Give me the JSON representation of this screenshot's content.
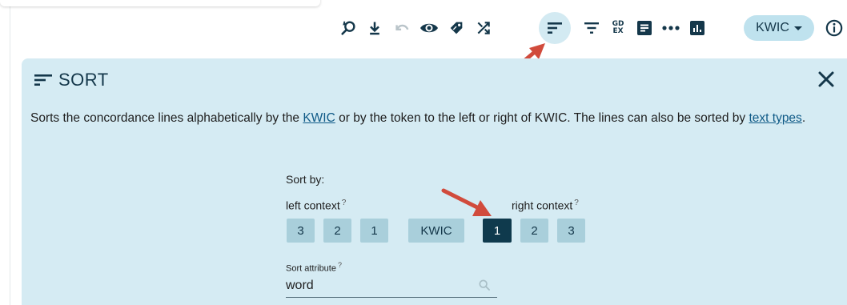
{
  "toolbar": {
    "icons": [
      "zoom-reset-icon",
      "download-icon",
      "undo-icon",
      "visibility-icon",
      "tag-icon",
      "shuffle-icon",
      "sort-icon",
      "filter-icon",
      "gdex-icon",
      "frequency-icon",
      "context-icon",
      "chart-icon",
      "info-icon"
    ],
    "gdex_top": "GD",
    "gdex_bottom": "EX",
    "view_mode": "KWIC"
  },
  "panel": {
    "title": "SORT",
    "desc_part1": "Sorts the concordance lines alphabetically by the ",
    "desc_link1": "KWIC",
    "desc_part2": " or by the token to the left or right of KWIC. The lines can also be sorted by ",
    "desc_link2": "text types",
    "desc_part3": ".",
    "sort_by_label": "Sort by:",
    "left_context_label": "left context",
    "right_context_label": "right context",
    "help_mark": "?",
    "left_buttons": [
      "3",
      "2",
      "1"
    ],
    "kwic_button": "KWIC",
    "right_buttons": [
      "1",
      "2",
      "3"
    ],
    "selected": "right-1",
    "attr_label": "Sort attribute",
    "attr_value": "word"
  },
  "colors": {
    "panel_bg": "#d5ebf3",
    "button_bg": "#a9cfdb",
    "button_selected": "#0f3a4d",
    "icon": "#14374a",
    "annotation_arrow": "#d14b3c"
  }
}
